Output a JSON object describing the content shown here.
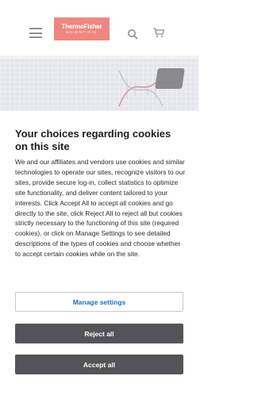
{
  "header": {
    "logo": {
      "line1": "ThermoFisher",
      "line2": "SCIENTIFIC"
    },
    "brand_color": "#e2231a",
    "icons": [
      "menu-icon",
      "search-icon",
      "cart-icon"
    ]
  },
  "cookie_banner": {
    "title": "Your choices regarding cookies on this site",
    "body": "We and our affiliates and vendors use cookies and similar technologies to operate our sites, recognize visitors to our sites, provide secure log-in, collect statistics to optimize site functionality, and deliver content tailored to your interests. Click Accept All to accept all cookies and go directly to the site, click Reject All to reject all but cookies strictly necessary to the functioning of this site (required cookies), or click on Manage Settings to see detailed descriptions of the types of cookies and choose whether to accept certain cookies while on the site.",
    "manage_label": "Manage settings",
    "reject_label": "Reject all",
    "accept_label": "Accept all",
    "link_color": "#1f6fb7",
    "button_color": "#545456"
  }
}
